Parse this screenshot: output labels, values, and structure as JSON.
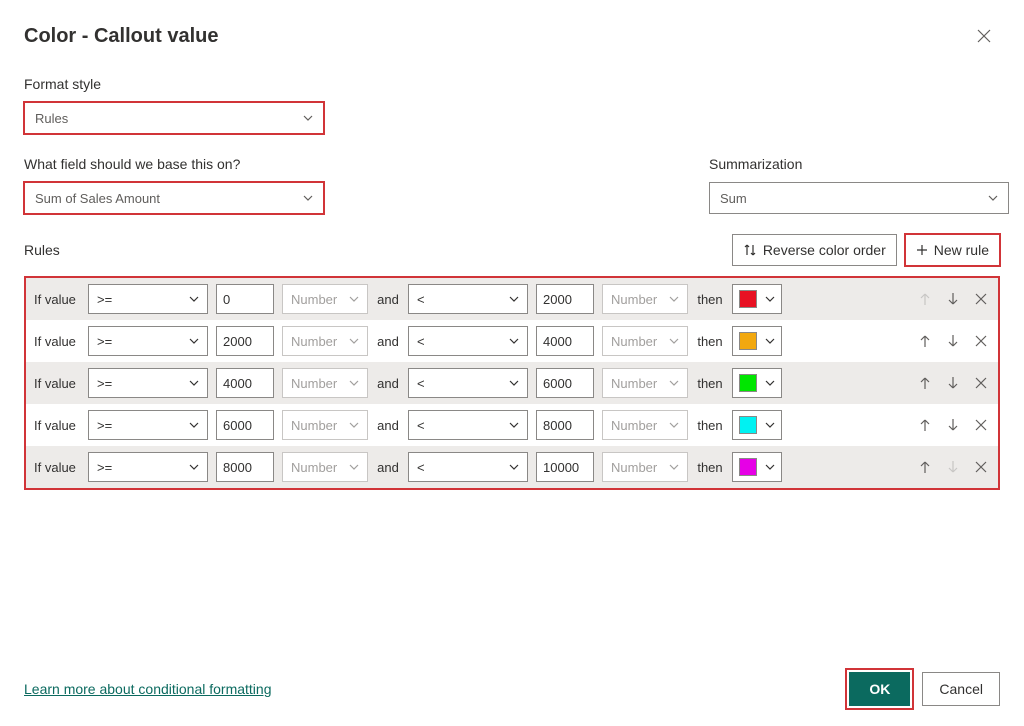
{
  "title": "Color - Callout value",
  "formatStyle": {
    "label": "Format style",
    "value": "Rules"
  },
  "basedOn": {
    "label": "What field should we base this on?",
    "value": "Sum of Sales Amount"
  },
  "summarization": {
    "label": "Summarization",
    "value": "Sum"
  },
  "rulesLabel": "Rules",
  "reverseColorOrder": "Reverse color order",
  "newRule": "New rule",
  "ifValue": "If value",
  "and": "and",
  "then": "then",
  "numberType": "Number",
  "rules": [
    {
      "op1": ">=",
      "val1": "0",
      "op2": "<",
      "val2": "2000",
      "color": "#e81123"
    },
    {
      "op1": ">=",
      "val1": "2000",
      "op2": "<",
      "val2": "4000",
      "color": "#f2a80f"
    },
    {
      "op1": ">=",
      "val1": "4000",
      "op2": "<",
      "val2": "6000",
      "color": "#00e600"
    },
    {
      "op1": ">=",
      "val1": "6000",
      "op2": "<",
      "val2": "8000",
      "color": "#00f2f2"
    },
    {
      "op1": ">=",
      "val1": "8000",
      "op2": "<",
      "val2": "10000",
      "color": "#e600e6"
    }
  ],
  "learnMore": "Learn more about conditional formatting",
  "ok": "OK",
  "cancel": "Cancel"
}
